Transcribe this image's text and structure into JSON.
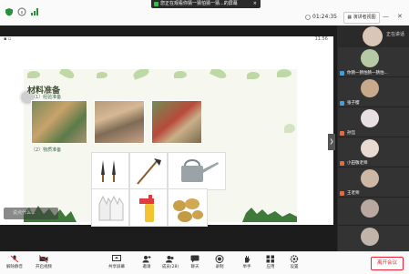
{
  "app": {
    "share_banner": "您正在观看你猜一猜怕猜一猜...的屏幕",
    "meeting_time": "01:24:35",
    "speaker_view_label": "演讲者视图",
    "speaking_label": "正在讲话"
  },
  "phone": {
    "status_time": "11:56"
  },
  "slide": {
    "title": "材料准备",
    "section1": "（1）经验准备",
    "section2": "（2）物质准备",
    "comment_placeholder": "说点什么..."
  },
  "participants": [
    {
      "name": "你猜一猜怕猜一猜怕..."
    },
    {
      "name": "张子樱"
    },
    {
      "name": "孙喆"
    },
    {
      "name": "小田敬老师"
    },
    {
      "name": "王老师"
    }
  ],
  "toolbar": {
    "mute": "解除静音",
    "video": "开启视频",
    "share": "共享屏幕",
    "invite": "邀请",
    "members": "成员(28)",
    "chat": "聊天",
    "record": "录制",
    "raise_hand": "举手",
    "apps": "应用",
    "settings": "设置",
    "leave": "离开会议"
  },
  "colors": {
    "leave": "#e22a2a",
    "panel_bg": "#2a2a2a",
    "slide_green": "#8fbf6a"
  }
}
